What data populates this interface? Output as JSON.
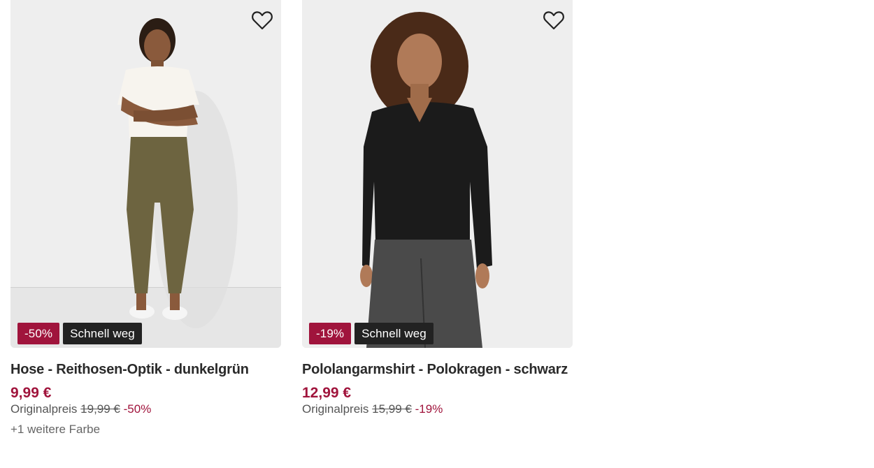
{
  "products": [
    {
      "title": "Hose - Reithosen-Optik - dunkelgrün",
      "price": "9,99 €",
      "original_label": "Originalpreis",
      "original_price": "19,99 €",
      "discount_text": "-50%",
      "badge_discount": "-50%",
      "badge_fast": "Schnell weg",
      "more_colors": "+1 weitere Farbe",
      "image_alt": "Model wearing olive green riding-style trousers and white top",
      "wishlist_icon": "heart-outline-icon"
    },
    {
      "title": "Pololangarmshirt - Polokragen - schwarz",
      "price": "12,99 €",
      "original_label": "Originalpreis",
      "original_price": "15,99 €",
      "discount_text": "-19%",
      "badge_discount": "-19%",
      "badge_fast": "Schnell weg",
      "image_alt": "Model wearing black long-sleeve polo shirt with grey trousers",
      "wishlist_icon": "heart-outline-icon"
    }
  ],
  "colors": {
    "accent": "#a0143c",
    "badge_dark": "#222222",
    "text": "#2a2a2a",
    "muted": "#666666"
  }
}
